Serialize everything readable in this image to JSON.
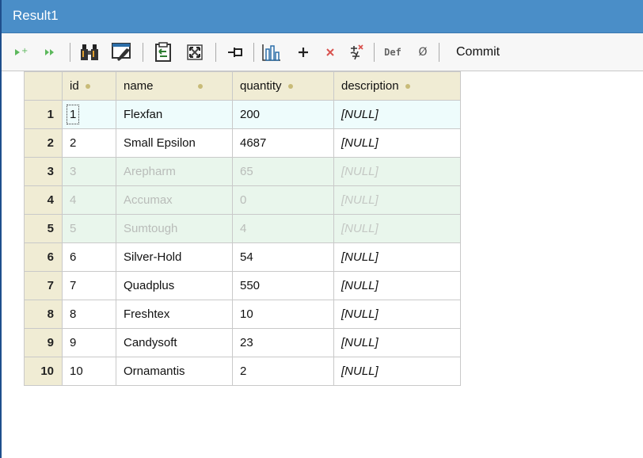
{
  "window": {
    "title": "Result1"
  },
  "toolbar": {
    "items": [
      {
        "name": "append-row-icon"
      },
      {
        "name": "fast-forward-icon"
      },
      {
        "name": "find-binoculars-icon"
      },
      {
        "name": "clear-filter-icon"
      },
      {
        "name": "copy-clipboard-icon"
      },
      {
        "name": "maximize-icon"
      },
      {
        "name": "pin-icon"
      },
      {
        "name": "chart-icon"
      },
      {
        "name": "add-row-icon"
      },
      {
        "name": "delete-row-icon"
      },
      {
        "name": "undo-changes-icon"
      },
      {
        "name": "set-default-icon"
      },
      {
        "name": "set-null-icon"
      }
    ],
    "def_label": "Def",
    "null_label": "Ø",
    "commit_label": "Commit"
  },
  "grid": {
    "columns": [
      "id",
      "name",
      "quantity",
      "description"
    ],
    "rows": [
      {
        "num": "1",
        "id": "1",
        "name": "Flexfan",
        "quantity": "200",
        "description": "[NULL]",
        "state": "current"
      },
      {
        "num": "2",
        "id": "2",
        "name": "Small Epsilon",
        "quantity": "4687",
        "description": "[NULL]",
        "state": "normal"
      },
      {
        "num": "3",
        "id": "3",
        "name": "Arepharm",
        "quantity": "65",
        "description": "[NULL]",
        "state": "deleted"
      },
      {
        "num": "4",
        "id": "4",
        "name": "Accumax",
        "quantity": "0",
        "description": "[NULL]",
        "state": "deleted"
      },
      {
        "num": "5",
        "id": "5",
        "name": "Sumtough",
        "quantity": "4",
        "description": "[NULL]",
        "state": "deleted"
      },
      {
        "num": "6",
        "id": "6",
        "name": "Silver-Hold",
        "quantity": "54",
        "description": "[NULL]",
        "state": "normal"
      },
      {
        "num": "7",
        "id": "7",
        "name": "Quadplus",
        "quantity": "550",
        "description": "[NULL]",
        "state": "normal"
      },
      {
        "num": "8",
        "id": "8",
        "name": "Freshtex",
        "quantity": "10",
        "description": "[NULL]",
        "state": "normal"
      },
      {
        "num": "9",
        "id": "9",
        "name": "Candysoft",
        "quantity": "23",
        "description": "[NULL]",
        "state": "normal"
      },
      {
        "num": "10",
        "id": "10",
        "name": "Ornamantis",
        "quantity": "2",
        "description": "[NULL]",
        "state": "normal"
      }
    ]
  },
  "colors": {
    "title_bar": "#4a8ec8",
    "header_bg": "#f0ecd4",
    "current_row_bg": "#eefcfc",
    "deleted_row_bg": "#e9f6ec"
  }
}
